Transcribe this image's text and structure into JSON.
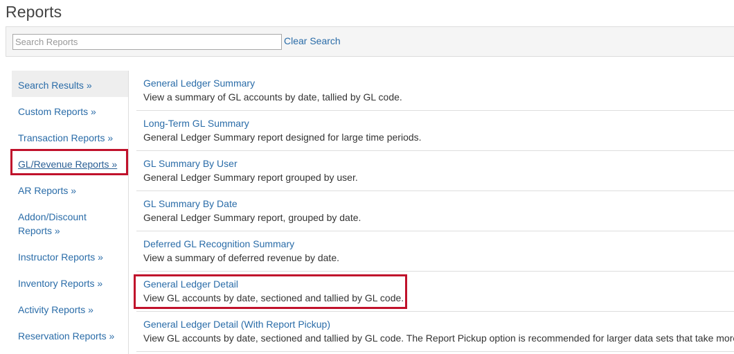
{
  "page": {
    "title": "Reports"
  },
  "search": {
    "placeholder": "Search Reports",
    "value": "",
    "clear_label": "Clear Search"
  },
  "sidebar": {
    "items": [
      {
        "label": "Search Results »"
      },
      {
        "label": "Custom Reports »"
      },
      {
        "label": "Transaction Reports »"
      },
      {
        "label": "GL/Revenue Reports »"
      },
      {
        "label": "AR Reports »"
      },
      {
        "label": "Addon/Discount Reports »"
      },
      {
        "label": "Instructor Reports »"
      },
      {
        "label": "Inventory Reports »"
      },
      {
        "label": "Activity Reports »"
      },
      {
        "label": "Reservation Reports »"
      }
    ]
  },
  "reports": [
    {
      "title": "General Ledger Summary",
      "description": "View a summary of GL accounts by date, tallied by GL code."
    },
    {
      "title": "Long-Term GL Summary",
      "description": "General Ledger Summary report designed for large time periods."
    },
    {
      "title": "GL Summary By User",
      "description": "General Ledger Summary report grouped by user."
    },
    {
      "title": "GL Summary By Date",
      "description": "General Ledger Summary report, grouped by date."
    },
    {
      "title": "Deferred GL Recognition Summary",
      "description": "View a summary of deferred revenue by date."
    },
    {
      "title": "General Ledger Detail",
      "description": "View GL accounts by date, sectioned and tallied by GL code."
    },
    {
      "title": "General Ledger Detail (With Report Pickup)",
      "description": "View GL accounts by date, sectioned and tallied by GL code. The Report Pickup option is recommended for larger data sets that take more time"
    }
  ],
  "colors": {
    "link": "#2a6ca8",
    "highlight_border": "#c0112b",
    "active_bg": "#eeeeee"
  }
}
